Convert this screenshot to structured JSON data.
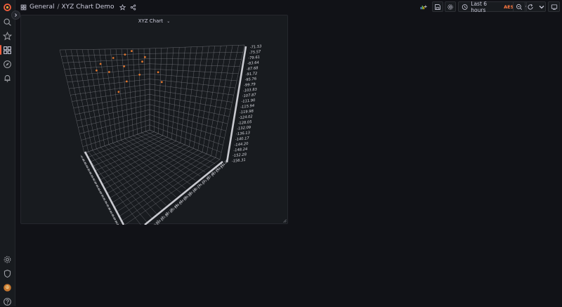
{
  "app": {
    "breadcrumb_root": "General",
    "breadcrumb_separator": "/",
    "dashboard_title": "XYZ Chart Demo"
  },
  "toolbar": {
    "time_range_label": "Last 6 hours",
    "timezone": "AEST"
  },
  "panel": {
    "title": "XYZ Chart",
    "chevron": "⌄"
  },
  "icons": {
    "sidebar": [
      "grafana-logo-icon",
      "search-icon",
      "star-icon",
      "dashboards-icon",
      "explore-icon",
      "alerting-icon",
      "gear-icon",
      "shield-icon",
      "avatar",
      "help-icon"
    ],
    "toolbar": [
      "add-panel-icon",
      "save-icon",
      "settings-icon",
      "clock-icon",
      "chevron-down-icon",
      "zoom-out-icon",
      "refresh-icon",
      "chevron-down-icon",
      "tv-mode-icon"
    ]
  },
  "colors": {
    "accent": "#f55f3e",
    "timezone": "#ff7941",
    "points": "#e0752d",
    "grid": "#7b7d84"
  },
  "chart_data": {
    "type": "scatter",
    "title": "XYZ Chart",
    "z_axis_ticks": [
      "-71.53",
      "-75.57",
      "-79.61",
      "-83.64",
      "-87.68",
      "-91.72",
      "-95.76",
      "-99.79",
      "-103.83",
      "-107.87",
      "-111.90",
      "-115.94",
      "-119.98",
      "-124.02",
      "-128.05",
      "-132.09",
      "-136.13",
      "-140.17",
      "-144.20",
      "-148.24",
      "-152.28",
      "-156.31"
    ],
    "y_axis_ticks": [
      "154.22",
      "158.64",
      "163.06",
      "167.48",
      "171.90",
      "176.32",
      "180.74",
      "185.16",
      "189.58",
      "194.00",
      "198.42",
      "202.84",
      "207.26",
      "211.68",
      "216.10",
      "220.52"
    ],
    "x_axis_ticks": [
      "-40.00",
      "-42.50",
      "-45.00",
      "-47.50",
      "-50.00",
      "-52.50",
      "-55.00",
      "-57.50",
      "-60.00",
      "-62.50",
      "-65.00",
      "-67.50",
      "-70.00",
      "-72.50",
      "-75.00",
      "-77.50",
      "-80.00",
      "-82.50",
      "-85.00",
      "-87.50",
      "-90.00",
      "-92.50",
      "-94.00"
    ],
    "points": [
      {
        "x": -45.2,
        "y": 160.1,
        "z": -80.2
      },
      {
        "x": -48.7,
        "y": 171.5,
        "z": -73.8
      },
      {
        "x": -52.1,
        "y": 178.2,
        "z": -76.9
      },
      {
        "x": -55.4,
        "y": 166.9,
        "z": -84.1
      },
      {
        "x": -58.8,
        "y": 190.3,
        "z": -79.5
      },
      {
        "x": -61.3,
        "y": 183.7,
        "z": -87.2
      },
      {
        "x": -64.9,
        "y": 197.4,
        "z": -91.0
      },
      {
        "x": -67.2,
        "y": 174.6,
        "z": -95.3
      },
      {
        "x": -70.6,
        "y": 205.8,
        "z": -83.7
      },
      {
        "x": -73.1,
        "y": 187.9,
        "z": -99.6
      },
      {
        "x": -76.5,
        "y": 212.2,
        "z": -88.4
      },
      {
        "x": -79.8,
        "y": 162.4,
        "z": -102.9
      },
      {
        "x": -82.0,
        "y": 199.1,
        "z": -106.5
      },
      {
        "x": -85.7,
        "y": 168.3,
        "z": -93.2
      }
    ]
  }
}
